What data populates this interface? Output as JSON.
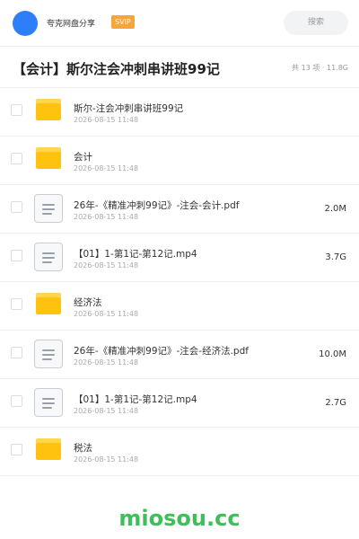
{
  "header": {
    "username": "夸克网盘分享",
    "badge": "SVIP",
    "search_label": "搜索"
  },
  "share": {
    "title": "【会计】斯尔注会冲刺串讲班99记",
    "meta": "共 13 项 · 11.8G"
  },
  "files": [
    {
      "type": "folder",
      "name": "斯尔-注会冲刺串讲班99记",
      "date": "2026-08-15 11:48",
      "size": ""
    },
    {
      "type": "folder",
      "name": "会计",
      "date": "2026-08-15 11:48",
      "size": ""
    },
    {
      "type": "file",
      "name": "26年-《精准冲刺99记》-注会-会计.pdf",
      "date": "2026-08-15 11:48",
      "size": "2.0M"
    },
    {
      "type": "file",
      "name": "【01】1-第1记-第12记.mp4",
      "date": "2026-08-15 11:48",
      "size": "3.7G"
    },
    {
      "type": "folder",
      "name": "经济法",
      "date": "2026-08-15 11:48",
      "size": ""
    },
    {
      "type": "file",
      "name": "26年-《精准冲刺99记》-注会-经济法.pdf",
      "date": "2026-08-15 11:48",
      "size": "10.0M"
    },
    {
      "type": "file",
      "name": "【01】1-第1记-第12记.mp4",
      "date": "2026-08-15 11:48",
      "size": "2.7G"
    },
    {
      "type": "folder",
      "name": "税法",
      "date": "2026-08-15 11:48",
      "size": ""
    }
  ],
  "watermark": "miosou.cc"
}
